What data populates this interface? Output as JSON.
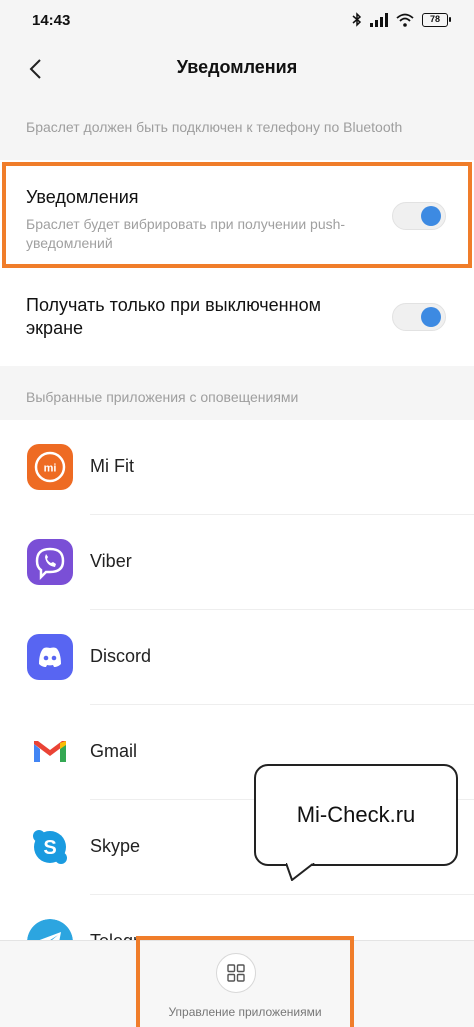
{
  "status_bar": {
    "time": "14:43",
    "battery": "78"
  },
  "header": {
    "title": "Уведомления"
  },
  "info_note": "Браслет должен быть подключен к телефону по Bluetooth",
  "notifications": {
    "title": "Уведомления",
    "description": "Браслет будет вибрировать при получении push-уведомлений",
    "enabled": true
  },
  "screen_off": {
    "title": "Получать только при выключенном экране",
    "enabled": true
  },
  "apps_section": {
    "header": "Выбранные приложения с оповещениями",
    "apps": [
      {
        "name": "Mi Fit",
        "icon": "mi-fit-icon",
        "color": "#ee6b23"
      },
      {
        "name": "Viber",
        "icon": "viber-icon",
        "color": "#7a4fd6"
      },
      {
        "name": "Discord",
        "icon": "discord-icon",
        "color": "#5865f2"
      },
      {
        "name": "Gmail",
        "icon": "gmail-icon",
        "color": "#ea4335"
      },
      {
        "name": "Skype",
        "icon": "skype-icon",
        "color": "#1a9be0"
      },
      {
        "name": "Telegram",
        "icon": "telegram-icon",
        "color": "#2ca5e0"
      }
    ]
  },
  "watermark": "Mi-Check.ru",
  "bottom_bar": {
    "manage_apps_label": "Управление приложениями"
  },
  "colors": {
    "accent": "#3d8ae2",
    "highlight": "#f07d2a"
  }
}
